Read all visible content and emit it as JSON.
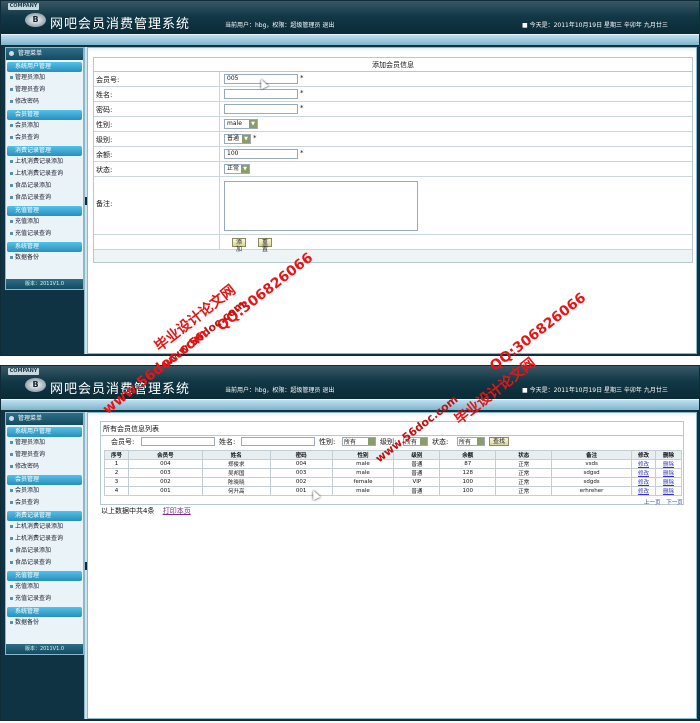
{
  "header": {
    "company": "COMPANY",
    "logo": "B",
    "title": "网吧会员消费管理系统",
    "user_info": "当前用户：hbg，权限：超级管理员    退出",
    "date_info": "■ 今天是：2011年10月19日 星期三 辛卯年 九月廿三"
  },
  "sidebar": {
    "top": "管理菜单",
    "groups": [
      {
        "title": "系统用户管理",
        "items": [
          "管理员添加",
          "管理员查询",
          "修改密码"
        ]
      },
      {
        "title": "会员管理",
        "items": [
          "会员添加",
          "会员查询"
        ]
      },
      {
        "title": "消费记录管理",
        "items": [
          "上机消费记录添加",
          "上机消费记录查询",
          "食品记录添加",
          "食品记录查询"
        ]
      },
      {
        "title": "充值管理",
        "items": [
          "充值添加",
          "充值记录查询"
        ]
      },
      {
        "title": "系统管理",
        "items": [
          "数据备份"
        ]
      }
    ],
    "footer": "版本：2011V1.0"
  },
  "form": {
    "title": "添加会员信息",
    "member_no_label": "会员号:",
    "member_no_value": "005",
    "name_label": "姓名:",
    "password_label": "密码:",
    "gender_label": "性别:",
    "gender_value": "male",
    "level_label": "级别:",
    "level_value": "普通",
    "balance_label": "余额:",
    "balance_value": "100",
    "status_label": "状态:",
    "status_value": "正常",
    "remark_label": "备注:",
    "required_mark": "*",
    "add_button": "添加",
    "reset_button": "重置"
  },
  "list": {
    "title": "所有会员信息列表",
    "search": {
      "member_no_label": "会员号:",
      "name_label": "姓名:",
      "gender_label": "性别:",
      "gender_value": "所有",
      "level_label": "级别:",
      "level_value": "所有",
      "status_label": "状态:",
      "status_value": "所有",
      "search_button": "查找"
    },
    "columns": [
      "序号",
      "会员号",
      "姓名",
      "密码",
      "性别",
      "级别",
      "余额",
      "状态",
      "备注",
      "修改",
      "删除"
    ],
    "rows": [
      [
        "1",
        "004",
        "郑俊求",
        "004",
        "male",
        "普通",
        "87",
        "正常",
        "vsds",
        "修改",
        "删除"
      ],
      [
        "2",
        "003",
        "吴邦国",
        "003",
        "male",
        "普通",
        "128",
        "正常",
        "sdgsd",
        "修改",
        "删除"
      ],
      [
        "3",
        "002",
        "陈晓晓",
        "002",
        "female",
        "VIP",
        "100",
        "正常",
        "sdgds",
        "修改",
        "删除"
      ],
      [
        "4",
        "001",
        "何升高",
        "001",
        "male",
        "普通",
        "100",
        "正常",
        "erhreher",
        "修改",
        "删除"
      ]
    ],
    "pager": {
      "prev": "上一页",
      "next": "下一页"
    },
    "summary": "以上数据中共4条",
    "print_link": "打印本页"
  },
  "watermarks": {
    "site_text": "毕业设计论文网",
    "qq": "QQ:306826066",
    "url": "www.56doc.com"
  },
  "colors": {
    "header_dark": "#0f3342",
    "menu_group": "#2a8fbd",
    "watermark_red": "#e81414",
    "link_blue": "#3333cc"
  }
}
